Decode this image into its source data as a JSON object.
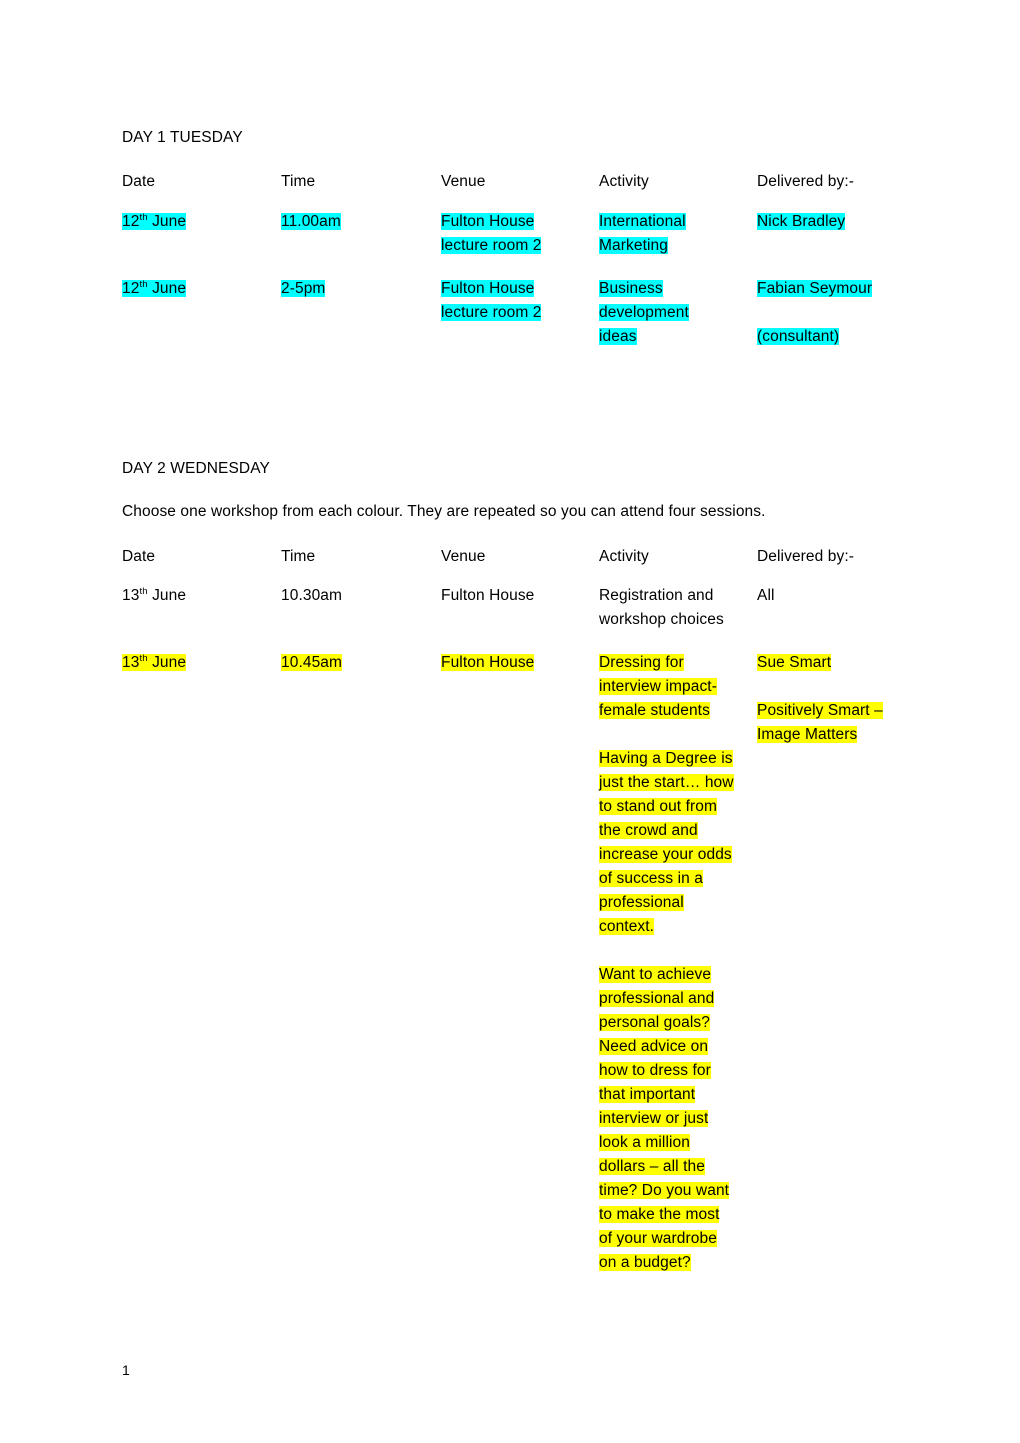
{
  "document": {
    "page_number": "1"
  },
  "day1": {
    "heading": "DAY 1 TUESDAY",
    "columns": {
      "date": "Date",
      "time": "Time",
      "venue": "Venue",
      "activity": "Activity",
      "delivered_by": "Delivered by:-"
    },
    "rows": [
      {
        "highlight": "cyan",
        "date_num": "12",
        "date_sup": "th",
        "date_month": " June",
        "time": "11.00am",
        "venue_lines": [
          "Fulton House",
          "lecture room 2"
        ],
        "activity_lines": [
          "International",
          "Marketing"
        ],
        "delivered_lines": [
          "Nick Bradley"
        ]
      },
      {
        "highlight": "cyan",
        "date_num": "12",
        "date_sup": "th",
        "date_month": " June",
        "time": "2-5pm",
        "venue_lines": [
          "Fulton House",
          "lecture room 2"
        ],
        "activity_lines": [
          "Business",
          "development",
          "ideas"
        ],
        "delivered_lines": [
          "Fabian Seymour",
          "",
          "(consultant)"
        ]
      }
    ]
  },
  "day2": {
    "heading": "DAY 2 WEDNESDAY",
    "instruction": "Choose one workshop from each colour. They are repeated so you can attend four sessions.",
    "columns": {
      "date": "Date",
      "time": "Time",
      "venue": "Venue",
      "activity": "Activity",
      "delivered_by": "Delivered by:-"
    },
    "rows": [
      {
        "highlight": "none",
        "date_num": "13",
        "date_sup": "th",
        "date_month": " June",
        "time": "10.30am",
        "venue_lines": [
          "Fulton House"
        ],
        "activity_lines": [
          "Registration and",
          "workshop choices"
        ],
        "delivered_lines": [
          "All"
        ]
      },
      {
        "highlight": "yellow",
        "date_num": "13",
        "date_sup": "th",
        "date_month": " June",
        "time": "10.45am",
        "venue_lines": [
          "Fulton House"
        ],
        "activity_lines": [
          "Dressing for",
          "interview impact-",
          "female students",
          "",
          "Having a Degree is",
          "just the start… how",
          "to stand out from",
          "the crowd and",
          "increase your odds",
          "of success in a",
          "professional",
          "context.",
          "",
          "Want to achieve",
          "professional and",
          "personal goals?",
          "Need advice on",
          "how to dress for",
          "that important",
          "interview or just",
          "look a million",
          "dollars – all the",
          "time? Do you want",
          "to make the most",
          "of your wardrobe",
          "on a budget?"
        ],
        "delivered_lines": [
          "Sue Smart",
          "",
          "Positively Smart –",
          "Image Matters"
        ]
      }
    ]
  },
  "colors": {
    "highlight_cyan": "#00ffff",
    "highlight_yellow": "#ffff00",
    "text": "#000000",
    "background": "#ffffff"
  }
}
